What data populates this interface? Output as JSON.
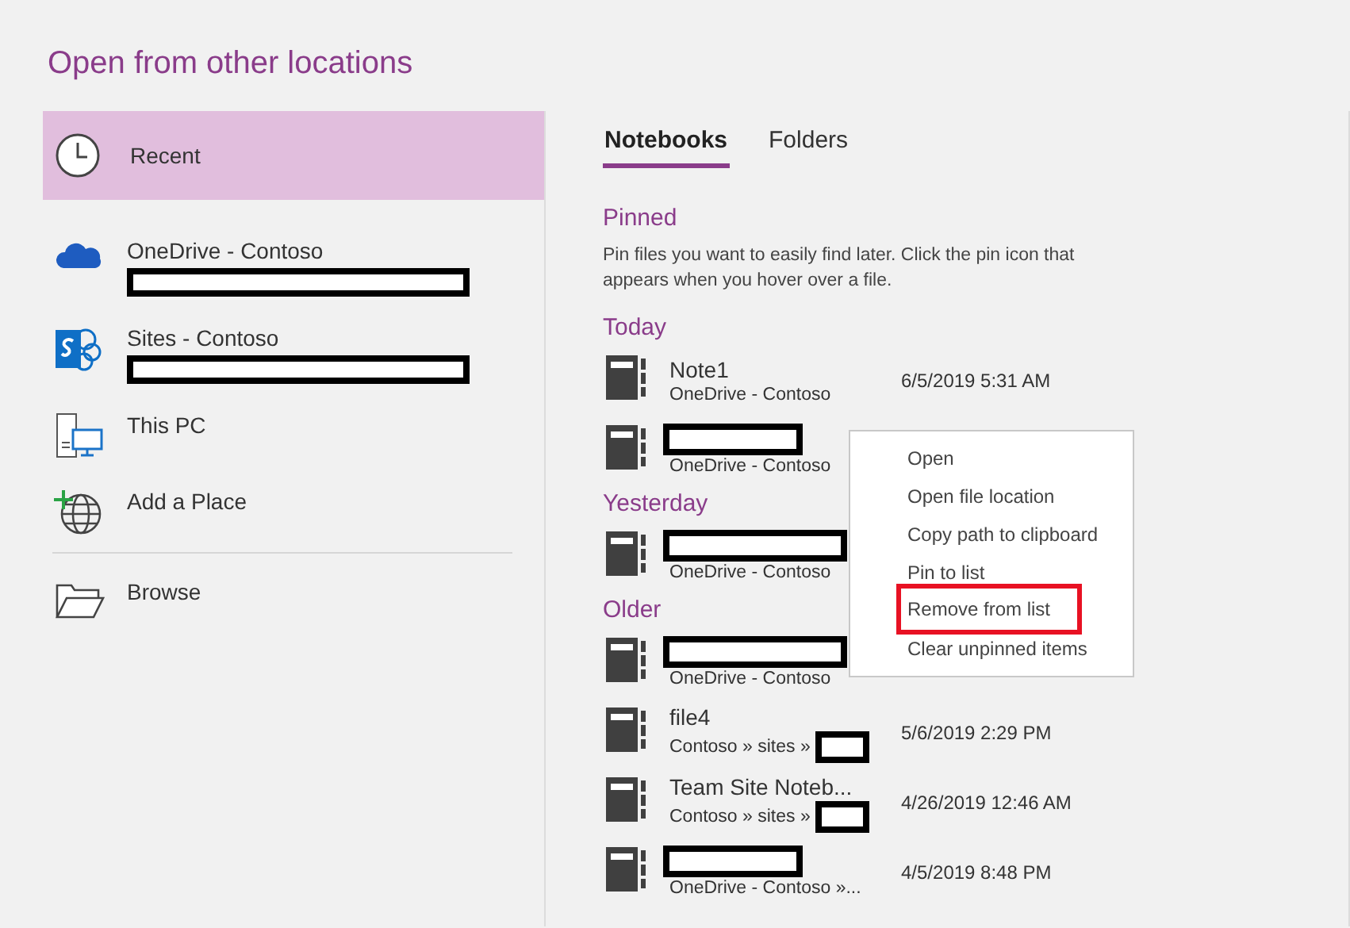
{
  "title": "Open from other locations",
  "sidebar": {
    "items": [
      {
        "kind": "clock",
        "label": "Recent",
        "selected": true,
        "account_redacted": false
      },
      {
        "kind": "cloud",
        "label": "OneDrive - Contoso",
        "selected": false,
        "account_redacted": true
      },
      {
        "kind": "sites",
        "label": "Sites - Contoso",
        "selected": false,
        "account_redacted": true
      },
      {
        "kind": "pc",
        "label": "This PC",
        "selected": false,
        "account_redacted": false
      },
      {
        "kind": "globe",
        "label": "Add a Place",
        "selected": false,
        "account_redacted": false
      },
      {
        "kind": "folder",
        "label": "Browse",
        "selected": false,
        "account_redacted": false
      }
    ]
  },
  "tabs": [
    {
      "label": "Notebooks",
      "selected": true
    },
    {
      "label": "Folders",
      "selected": false
    }
  ],
  "pinned": {
    "heading": "Pinned",
    "hint": "Pin files you want to easily find later. Click the pin icon that appears when you hover over a file."
  },
  "groups": [
    {
      "heading": "Today",
      "rows": [
        {
          "name": "Note1",
          "name_redacted": false,
          "location": "OneDrive - Contoso",
          "date": "6/5/2019 5:31 AM"
        },
        {
          "name_redacted": true,
          "location": "OneDrive - Contoso"
        }
      ]
    },
    {
      "heading": "Yesterday",
      "rows": [
        {
          "name_redacted": true,
          "location": "OneDrive - Contoso"
        }
      ]
    },
    {
      "heading": "Older",
      "rows": [
        {
          "name_redacted": true,
          "location": "OneDrive - Contoso"
        },
        {
          "name": "file4",
          "name_redacted": false,
          "location": "Contoso » sites »",
          "location_redacted": true,
          "date": "5/6/2019 2:29 PM"
        },
        {
          "name": "Team Site Noteb...",
          "name_redacted": false,
          "location": "Contoso » sites »",
          "location_redacted": true,
          "date": "4/26/2019 12:46 AM"
        },
        {
          "name_redacted": true,
          "location": "OneDrive - Contoso »...",
          "date": "4/5/2019 8:48 PM"
        }
      ]
    }
  ],
  "context_menu": {
    "items": [
      {
        "label": "Open",
        "highlighted": false
      },
      {
        "label": "Open file location",
        "highlighted": false
      },
      {
        "label": "Copy path to clipboard",
        "highlighted": false
      },
      {
        "label": "Pin to list",
        "highlighted": false
      },
      {
        "label": "Remove from list",
        "highlighted": true
      },
      {
        "label": "Clear unpinned items",
        "highlighted": false
      }
    ]
  }
}
